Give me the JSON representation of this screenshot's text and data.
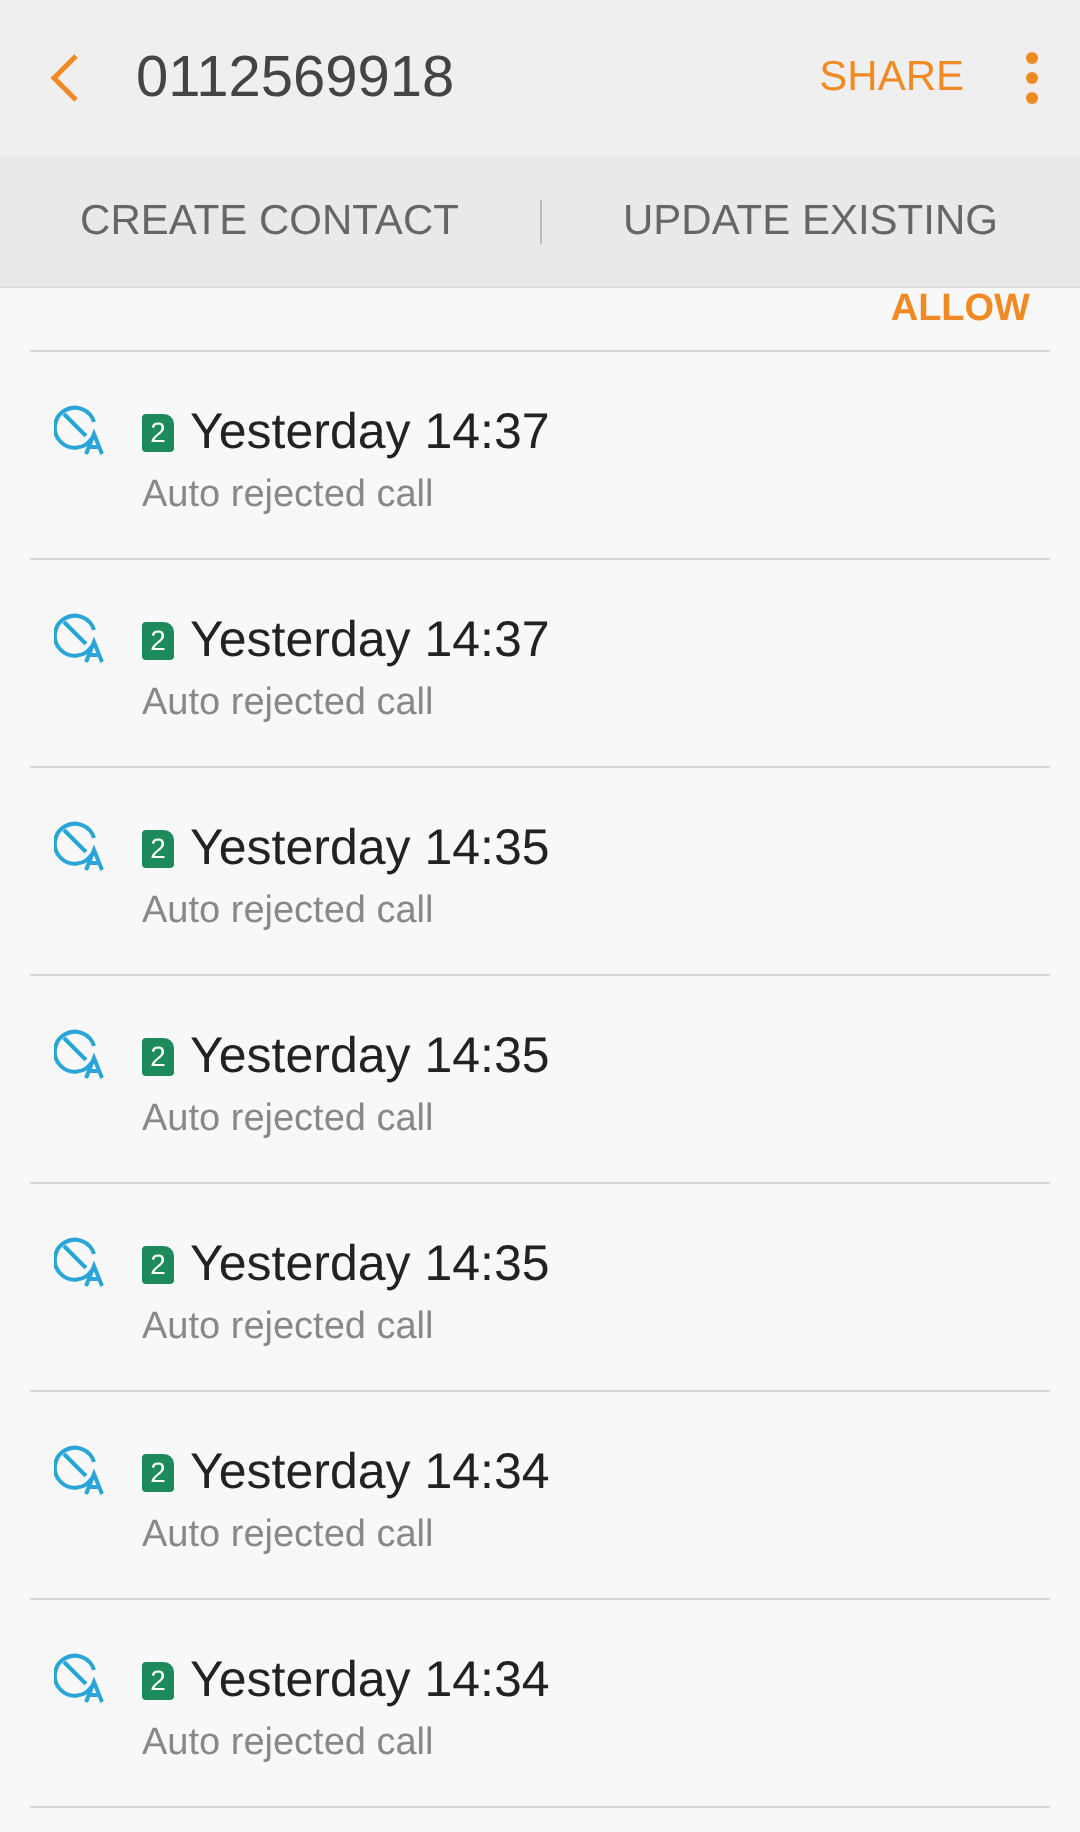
{
  "header": {
    "title": "0112569918",
    "share": "SHARE"
  },
  "actions": [
    "CREATE CONTACT",
    "UPDATE EXISTING"
  ],
  "allow": "ALLOW",
  "calls": [
    {
      "sim": "2",
      "time": "Yesterday 14:37",
      "type": "Auto rejected call"
    },
    {
      "sim": "2",
      "time": "Yesterday 14:37",
      "type": "Auto rejected call"
    },
    {
      "sim": "2",
      "time": "Yesterday 14:35",
      "type": "Auto rejected call"
    },
    {
      "sim": "2",
      "time": "Yesterday 14:35",
      "type": "Auto rejected call"
    },
    {
      "sim": "2",
      "time": "Yesterday 14:35",
      "type": "Auto rejected call"
    },
    {
      "sim": "2",
      "time": "Yesterday 14:34",
      "type": "Auto rejected call"
    },
    {
      "sim": "2",
      "time": "Yesterday 14:34",
      "type": "Auto rejected call"
    }
  ]
}
